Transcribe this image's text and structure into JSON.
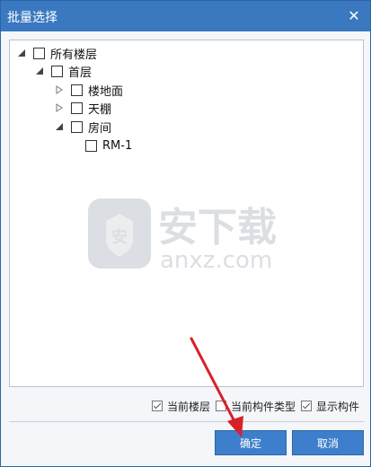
{
  "dialog": {
    "title": "批量选择",
    "close_label": "✕"
  },
  "tree": {
    "root": {
      "label": "所有楼层"
    },
    "floor": {
      "label": "首层"
    },
    "children": [
      {
        "label": "楼地面"
      },
      {
        "label": "天棚"
      },
      {
        "label": "房间"
      }
    ],
    "room": {
      "label": "RM-1"
    }
  },
  "watermark": {
    "text_main": "安下载",
    "text_sub": "anxz.com",
    "badge_char": "安"
  },
  "options": [
    {
      "label": "当前楼层",
      "checked": true
    },
    {
      "label": "当前构件类型",
      "checked": false
    },
    {
      "label": "显示构件",
      "checked": true
    }
  ],
  "buttons": {
    "ok_label": "确定",
    "cancel_label": "取消"
  },
  "colors": {
    "titlebar": "#3a78c0",
    "button": "#3d7fcc",
    "arrow": "#d8202a"
  }
}
